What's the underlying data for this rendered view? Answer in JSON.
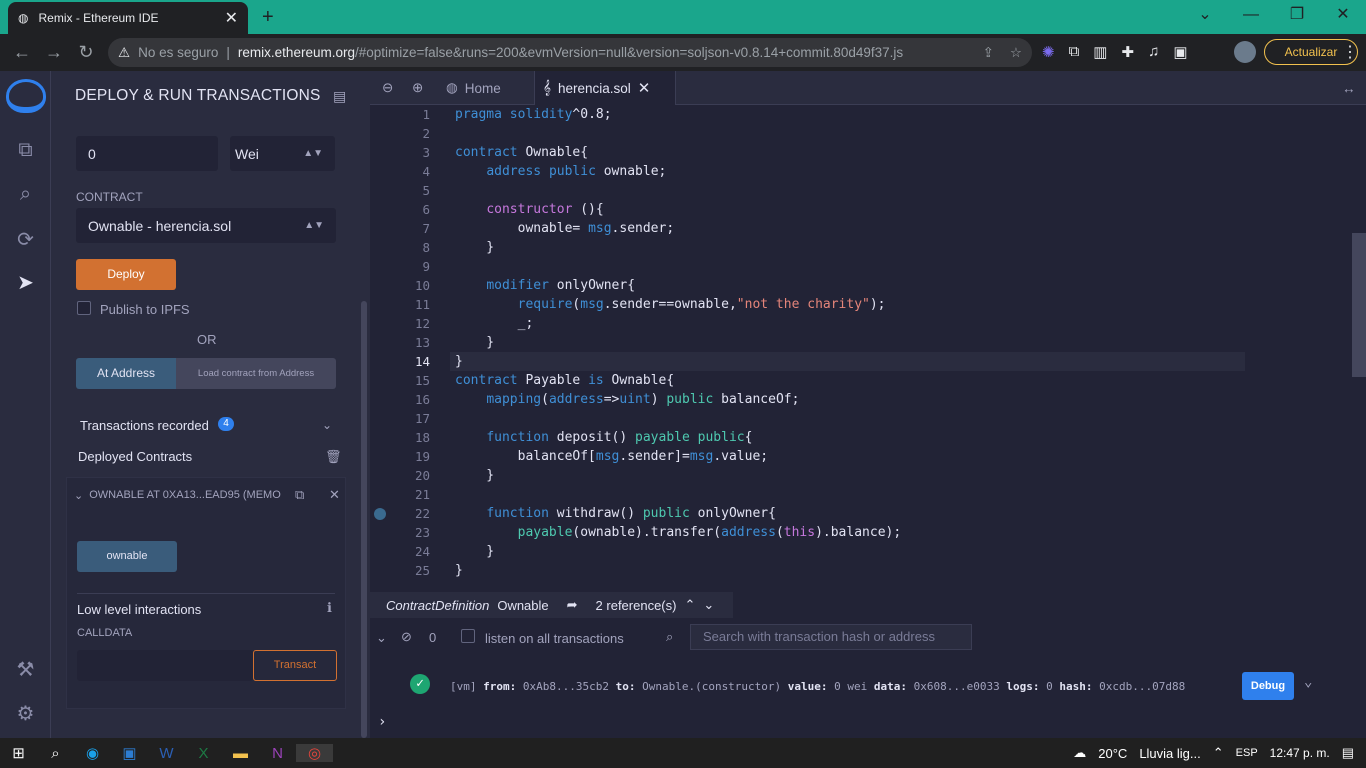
{
  "browser": {
    "tab_title": "Remix - Ethereum IDE",
    "tab_close": "✕",
    "new_tab": "+",
    "security": "No es seguro",
    "url_domain": "remix.ethereum.org",
    "url_path": "/#optimize=false&runs=200&evmVersion=null&version=soljson-v0.8.14+commit.80d49f37.js",
    "update_button": "Actualizar"
  },
  "panel": {
    "title": "DEPLOY & RUN TRANSACTIONS",
    "value_input": "0",
    "unit_select": "Wei",
    "contract_label": "CONTRACT",
    "contract_select": "Ownable - herencia.sol",
    "deploy_button": "Deploy",
    "publish_ipfs": "Publish to IPFS",
    "or_text": "OR",
    "at_address_button": "At Address",
    "load_address_placeholder": "Load contract from Address",
    "tx_recorded_label": "Transactions recorded",
    "tx_recorded_count": "4",
    "deployed_contracts_label": "Deployed Contracts",
    "instance_title": "OWNABLE AT 0XA13...EAD95 (MEMO",
    "ownable_button": "ownable",
    "low_level_label": "Low level interactions",
    "calldata_label": "CALLDATA",
    "transact_button": "Transact"
  },
  "editor": {
    "tab_home": "Home",
    "tab_file": "herencia.sol",
    "current_line": 14,
    "breakpoint_line": 22,
    "line_numbers": [
      "1",
      "2",
      "3",
      "4",
      "5",
      "6",
      "7",
      "8",
      "9",
      "10",
      "11",
      "12",
      "13",
      "14",
      "15",
      "16",
      "17",
      "18",
      "19",
      "20",
      "21",
      "22",
      "23",
      "24",
      "25"
    ],
    "reference_label": "ContractDefinition",
    "reference_name": "Ownable",
    "reference_count": "2 reference(s)"
  },
  "terminal": {
    "count": "0",
    "listen_label": "listen on all transactions",
    "search_placeholder": "Search with transaction hash or address",
    "log_prefix": "[vm]",
    "from_label": "from:",
    "from_value": "0xAb8...35cb2",
    "to_label": "to:",
    "to_value": "Ownable.(constructor)",
    "value_label": "value:",
    "value_value": "0 wei",
    "data_label": "data:",
    "data_value": "0x608...e0033",
    "logs_label": "logs:",
    "logs_value": "0",
    "hash_label": "hash:",
    "hash_value": "0xcdb...07d88",
    "debug_button": "Debug",
    "prompt": "›"
  },
  "taskbar": {
    "temperature": "20°C",
    "weather": "Lluvia lig...",
    "language": "ESP",
    "time": "12:47 p. m."
  },
  "colors": {
    "accent": "#2f80ed",
    "deploy": "#d27131",
    "browser_bar": "#1aa68c"
  }
}
